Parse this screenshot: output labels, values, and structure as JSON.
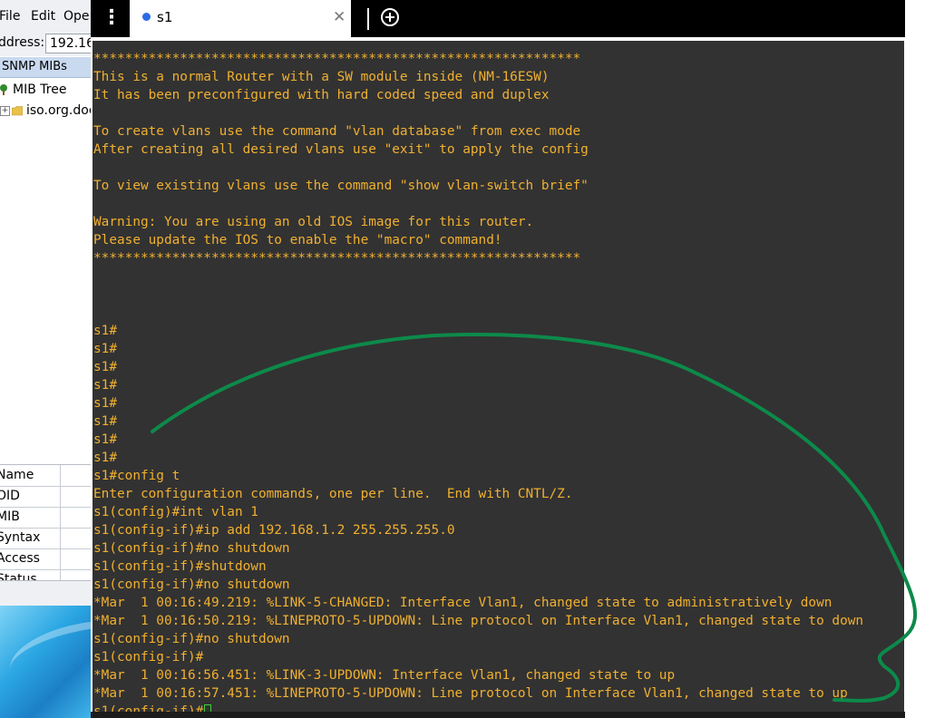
{
  "mib_browser": {
    "menu": [
      "File",
      "Edit",
      "Ope"
    ],
    "address_label": "ddress:",
    "address_value": "192.16",
    "panel_tab": "SNMP MIBs",
    "tree": [
      {
        "label": "MIB Tree",
        "icon": "tree-icon"
      },
      {
        "label": "iso.org.doc",
        "icon": "folder-icon"
      }
    ],
    "properties": [
      "Name",
      "OID",
      "MIB",
      "Syntax",
      "Access",
      "Status"
    ]
  },
  "terminal_app": {
    "tab": {
      "title": "s1",
      "status_color": "#2b6be3"
    },
    "icons": [
      "more-vert-icon",
      "close-icon",
      "plus-circle-icon"
    ]
  },
  "terminal": {
    "text_color": "#f0b030",
    "background": "#323232",
    "cursor_color": "#3bd13b",
    "lines": [
      "**************************************************************",
      "This is a normal Router with a SW module inside (NM-16ESW)",
      "It has been preconfigured with hard coded speed and duplex",
      "",
      "To create vlans use the command \"vlan database\" from exec mode",
      "After creating all desired vlans use \"exit\" to apply the config",
      "",
      "To view existing vlans use the command \"show vlan-switch brief\"",
      "",
      "Warning: You are using an old IOS image for this router.",
      "Please update the IOS to enable the \"macro\" command!",
      "**************************************************************",
      "",
      "",
      "",
      "s1#",
      "s1#",
      "s1#",
      "s1#",
      "s1#",
      "s1#",
      "s1#",
      "s1#",
      "s1#config t",
      "Enter configuration commands, one per line.  End with CNTL/Z.",
      "s1(config)#int vlan 1",
      "s1(config-if)#ip add 192.168.1.2 255.255.255.0",
      "s1(config-if)#no shutdown",
      "s1(config-if)#shutdown",
      "s1(config-if)#no shutdown",
      "*Mar  1 00:16:49.219: %LINK-5-CHANGED: Interface Vlan1, changed state to administratively down",
      "*Mar  1 00:16:50.219: %LINEPROTO-5-UPDOWN: Line protocol on Interface Vlan1, changed state to down",
      "s1(config-if)#no shutdown",
      "s1(config-if)#",
      "*Mar  1 00:16:56.451: %LINK-3-UPDOWN: Interface Vlan1, changed state to up",
      "*Mar  1 00:16:57.451: %LINEPROTO-5-UPDOWN: Line protocol on Interface Vlan1, changed state to up",
      "s1(config-if)#"
    ]
  },
  "annotation": {
    "color": "#0d8a4a"
  }
}
